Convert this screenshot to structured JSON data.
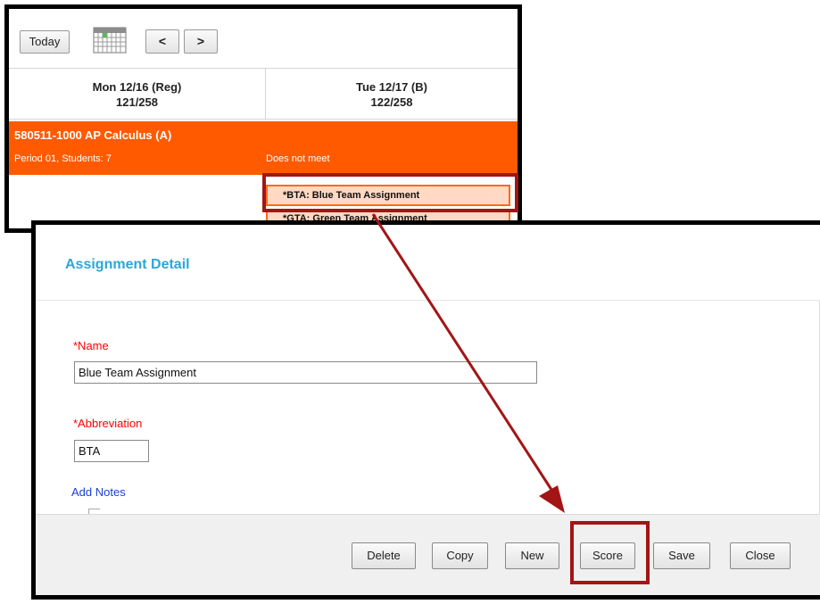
{
  "calendar": {
    "today_label": "Today",
    "prev_label": "<",
    "next_label": ">",
    "days": [
      {
        "name": "Mon 12/16 (Reg)",
        "count": "121/258"
      },
      {
        "name": "Tue 12/17 (B)",
        "count": "122/258"
      }
    ],
    "course": {
      "title": "580511-1000 AP Calculus (A)",
      "subtitle": "Period 01, Students: 7",
      "tuesday_note": "Does not meet"
    },
    "assignments": [
      {
        "label": "*BTA: Blue Team Assignment"
      },
      {
        "label": "*GTA: Green Team Assignment"
      }
    ]
  },
  "dialog": {
    "title": "Assignment Detail",
    "name_label": "*Name",
    "name_value": "Blue Team Assignment",
    "abbr_label": "*Abbreviation",
    "abbr_value": "BTA",
    "add_notes": "Add Notes",
    "buttons": {
      "delete": "Delete",
      "copy": "Copy",
      "new": "New",
      "score": "Score",
      "save": "Save",
      "close": "Close"
    }
  },
  "colors": {
    "accent_orange": "#ff5a00",
    "highlight_red": "#a31515",
    "title_blue": "#2ea6d6",
    "required_red": "#ff0000",
    "link_blue": "#1a3fd6"
  }
}
